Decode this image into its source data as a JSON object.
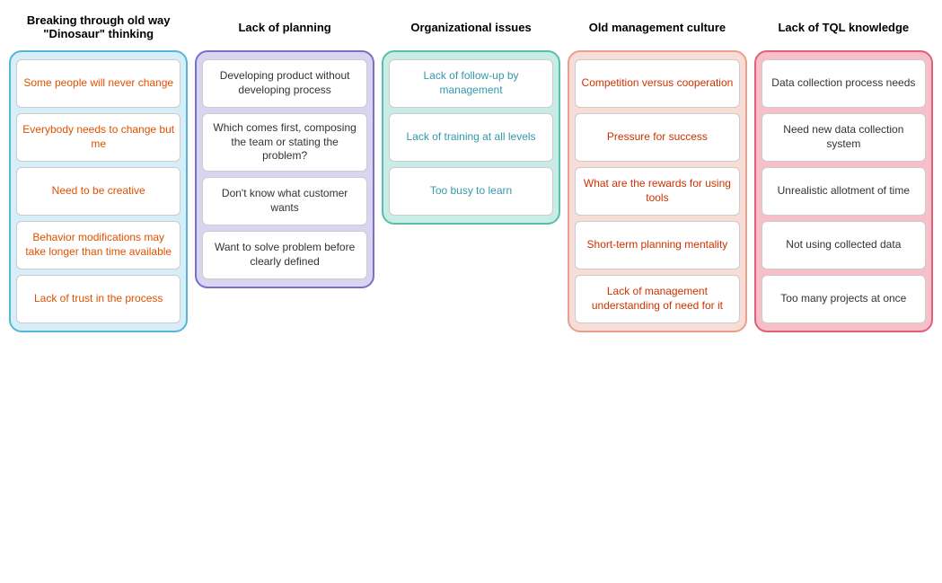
{
  "columns": [
    {
      "id": "col-1",
      "header": "Breaking through old way \"Dinosaur\" thinking",
      "cards": [
        "Some people will never change",
        "Everybody needs to change but me",
        "Need to be creative",
        "Behavior modifications may take longer than time available",
        "Lack of trust in the process"
      ]
    },
    {
      "id": "col-2",
      "header": "Lack of planning",
      "cards": [
        "Developing product without developing process",
        "Which comes first, composing the team or stating the problem?",
        "Don't know what customer wants",
        "Want to solve problem before clearly defined"
      ]
    },
    {
      "id": "col-3",
      "header": "Organizational issues",
      "cards": [
        "Lack of follow-up by management",
        "Lack of training at all levels",
        "Too busy to learn"
      ]
    },
    {
      "id": "col-4",
      "header": "Old management culture",
      "cards": [
        "Competition versus cooperation",
        "Pressure for success",
        "What are the rewards for using tools",
        "Short-term planning mentality",
        "Lack of management understanding of need for it"
      ]
    },
    {
      "id": "col-5",
      "header": "Lack of TQL knowledge",
      "cards": [
        "Data collection process needs",
        "Need new data collection system",
        "Unrealistic allotment of time",
        "Not using collected data",
        "Too many projects at once"
      ]
    }
  ]
}
